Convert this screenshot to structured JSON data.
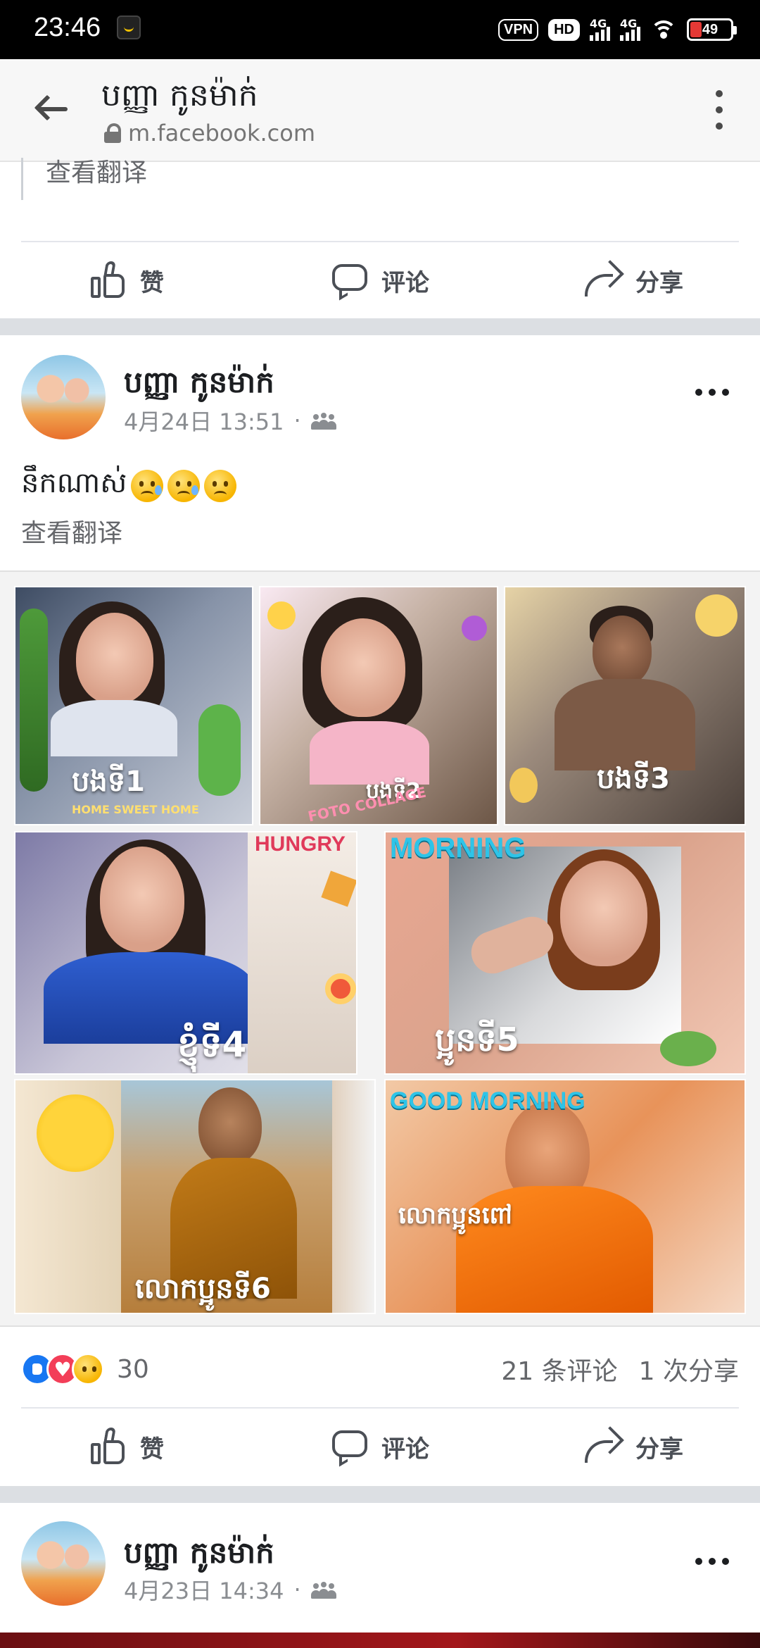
{
  "status_bar": {
    "time": "23:46",
    "vpn": "VPN",
    "hd": "HD",
    "net1": "4G",
    "net2": "4G",
    "battery": "49"
  },
  "header": {
    "title": "បញ្ញា កូនម៉ាក់",
    "url": "m.facebook.com"
  },
  "prev_post": {
    "translate": "查看翻译",
    "actions": {
      "like": "赞",
      "comment": "评论",
      "share": "分享"
    }
  },
  "post": {
    "author": "បញ្ញា កូនម៉ាក់",
    "date": "4月24日 13:51",
    "separator": "·",
    "text": "នឹកណាស់",
    "translate": "查看翻译",
    "collage": {
      "captions": [
        "បងទី1",
        "បងទី2",
        "បងទី3",
        "ខ្ញុំទី4",
        "ប្អូនទី5",
        "លោកប្អូនទី6",
        "លោកប្អូនពៅ"
      ],
      "stickers": [
        "HOME SWEET HOME",
        "FOTO COLLAGE",
        "HUNGRY",
        "MORNING",
        "GOOD MORNING"
      ]
    },
    "reaction_count": "30",
    "comments": "21 条评论",
    "shares": "1 次分享",
    "actions": {
      "like": "赞",
      "comment": "评论",
      "share": "分享"
    }
  },
  "next_post": {
    "author": "បញ្ញា កូនម៉ាក់",
    "date": "4月23日 14:34",
    "separator": "·"
  },
  "colors": {
    "link_blue": "#1877f2",
    "love_red": "#f33e58",
    "muted_text": "#65676b",
    "divider_gray": "#dcdfe3"
  },
  "icons": [
    "back-arrow-icon",
    "lock-icon",
    "kebab-menu-icon",
    "like-icon",
    "comment-icon",
    "share-icon",
    "friends-icon",
    "more-icon"
  ]
}
